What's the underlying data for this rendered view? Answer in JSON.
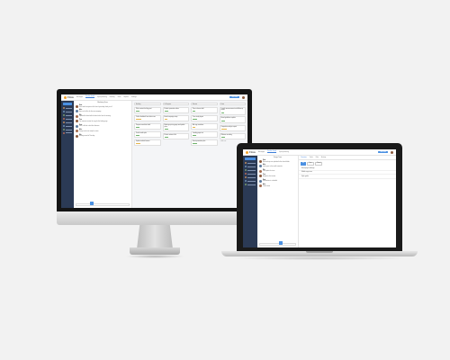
{
  "app": {
    "logo": "Flow",
    "nav": [
      "Messages",
      "Kanban board",
      "Sprint planning",
      "Backlog",
      "Team",
      "Reports",
      "Settings"
    ],
    "new_button": "New task"
  },
  "imac": {
    "chat_title": "Marketing Team",
    "messages": [
      {
        "name": "Kate",
        "text": "Great work everyone on the launch yesterday, thank you all"
      },
      {
        "name": "Alex",
        "text": "Here are the files for the new campaign"
      },
      {
        "name": "Mia",
        "text": "Updated the board with the latest tasks from the meeting"
      },
      {
        "name": "Tom",
        "text": "Can someone review the copy for the landing page"
      },
      {
        "name": "Kate",
        "text": "Sure, I will take a look this afternoon"
      },
      {
        "name": "Alex",
        "text": "Design assets are ready for review"
      },
      {
        "name": "Mia",
        "text": "Meeting moved to Thursday"
      }
    ],
    "columns": [
      {
        "title": "Backlog",
        "cards": [
          {
            "text": "Write content for blog post",
            "tag": "Mktg"
          },
          {
            "text": "Collect feedback from beta users",
            "tag": "Research"
          },
          {
            "text": "Prepare newsletter draft",
            "tag": "Mktg"
          },
          {
            "text": "Social media plan",
            "tag": "Social"
          },
          {
            "text": "Update website banner",
            "tag": "Design"
          }
        ]
      },
      {
        "title": "In Progress",
        "cards": [
          {
            "text": "Product promotion video",
            "tag": "Video"
          },
          {
            "text": "Email campaign setup",
            "tag": "Mktg"
          },
          {
            "text": "Redesign pricing page and update plans",
            "tag": "Design"
          },
          {
            "text": "Partner outreach list",
            "tag": "Sales"
          }
        ]
      },
      {
        "title": "Review",
        "cards": [
          {
            "text": "Press release draft",
            "tag": "PR"
          },
          {
            "text": "Case study layout",
            "tag": "Design"
          },
          {
            "text": "Ad copy variations",
            "tag": "Ads"
          },
          {
            "text": "Landing page test",
            "tag": "Web"
          },
          {
            "text": "Event promotion plan",
            "tag": "Events"
          }
        ]
      },
      {
        "title": "Done",
        "cards": [
          {
            "text": "Launch announcement and follow-up emails",
            "tag": "Mktg"
          },
          {
            "text": "Brand guidelines update",
            "tag": "Design"
          },
          {
            "text": "Competitor analysis report",
            "tag": "Research"
          },
          {
            "text": "Webinar recording",
            "tag": "Video"
          }
        ]
      }
    ],
    "add_card": "+ Add card"
  },
  "laptop": {
    "chat_title": "Design Team",
    "messages": [
      {
        "name": "Kate",
        "text": "New mockups are uploaded to the shared folder"
      },
      {
        "name": "Alex",
        "text": "Looks great, a few small comments"
      },
      {
        "name": "Mia",
        "text": "I will update the icons"
      },
      {
        "name": "Tom",
        "text": "Ready for client review"
      },
      {
        "name": "Kate",
        "text": "Presentation is scheduled"
      },
      {
        "name": "Alex",
        "text": "Thanks team"
      }
    ],
    "tabs": [
      "Overview",
      "Tasks",
      "Files",
      "Activity"
    ],
    "toolbar": [
      "All",
      "Open",
      "Closed"
    ],
    "rows": [
      "Homepage redesign",
      "Mobile app icons",
      "Style guide"
    ]
  }
}
